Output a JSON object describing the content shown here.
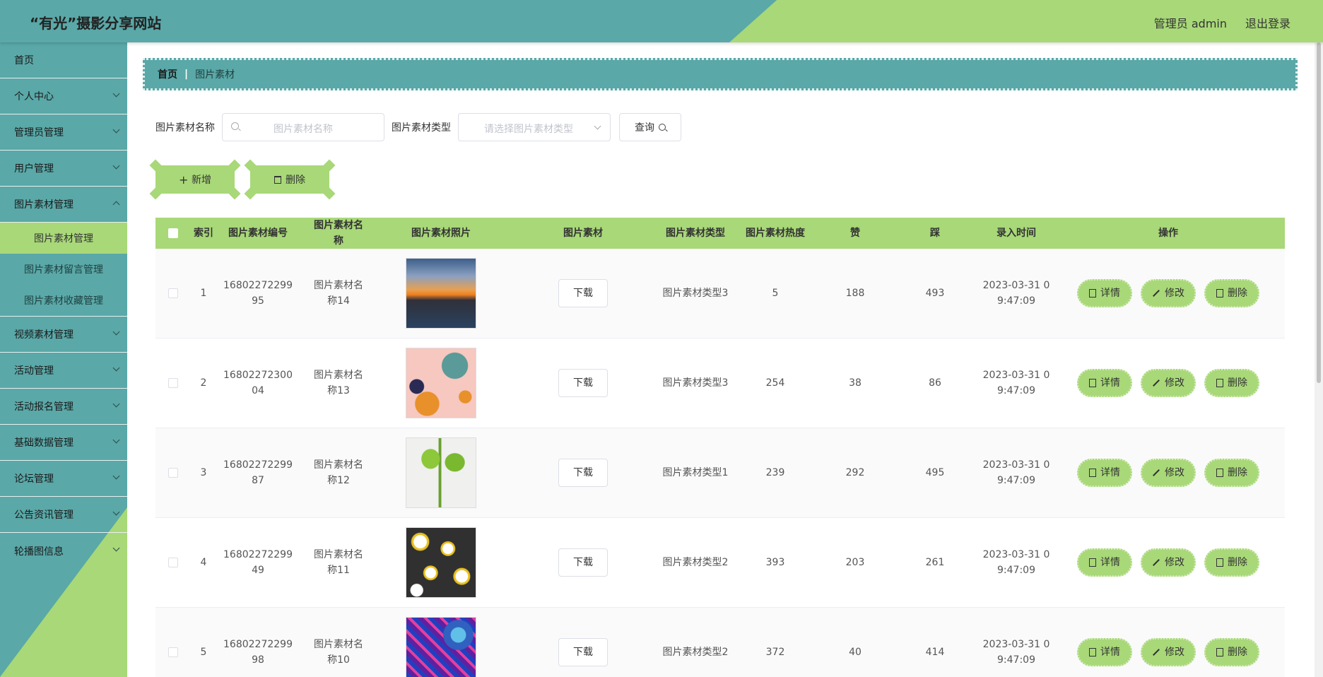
{
  "header": {
    "title": "“有光”摄影分享网站",
    "user": "管理员 admin",
    "logout": "退出登录"
  },
  "sidebar": {
    "items": [
      {
        "label": "首页",
        "has_arrow": false
      },
      {
        "label": "个人中心",
        "has_arrow": true
      },
      {
        "label": "管理员管理",
        "has_arrow": true
      },
      {
        "label": "用户管理",
        "has_arrow": true
      },
      {
        "label": "图片素材管理",
        "has_arrow": true,
        "open": true
      },
      {
        "label": "视频素材管理",
        "has_arrow": true
      },
      {
        "label": "活动管理",
        "has_arrow": true
      },
      {
        "label": "活动报名管理",
        "has_arrow": true
      },
      {
        "label": "基础数据管理",
        "has_arrow": true
      },
      {
        "label": "论坛管理",
        "has_arrow": true
      },
      {
        "label": "公告资讯管理",
        "has_arrow": true
      },
      {
        "label": "轮播图信息",
        "has_arrow": true
      }
    ],
    "submenu": [
      "图片素材管理",
      "图片素材留言管理",
      "图片素材收藏管理"
    ]
  },
  "breadcrumb": {
    "home": "首页",
    "separator": "|",
    "current": "图片素材"
  },
  "search": {
    "name_label": "图片素材名称",
    "name_placeholder": "图片素材名称",
    "type_label": "图片素材类型",
    "type_placeholder": "请选择图片素材类型",
    "query_label": "查询"
  },
  "actions": {
    "add_label": "新增",
    "delete_label": "删除"
  },
  "table": {
    "headers": [
      "索引",
      "图片素材编号",
      "图片素材名称",
      "图片素材照片",
      "图片素材",
      "图片素材类型",
      "图片素材热度",
      "赞",
      "踩",
      "录入时间",
      "操作"
    ],
    "download_label": "下载",
    "op_labels": {
      "detail": "详情",
      "edit": "修改",
      "delete": "删除"
    },
    "rows": [
      {
        "index": "1",
        "code": "1680227229995",
        "name": "图片素材名称14",
        "type": "图片素材类型3",
        "heat": "5",
        "zan": "188",
        "cai": "493",
        "time": "2023-03-31 09:47:09"
      },
      {
        "index": "2",
        "code": "1680227230004",
        "name": "图片素材名称13",
        "type": "图片素材类型3",
        "heat": "254",
        "zan": "38",
        "cai": "86",
        "time": "2023-03-31 09:47:09"
      },
      {
        "index": "3",
        "code": "1680227229987",
        "name": "图片素材名称12",
        "type": "图片素材类型1",
        "heat": "239",
        "zan": "292",
        "cai": "495",
        "time": "2023-03-31 09:47:09"
      },
      {
        "index": "4",
        "code": "1680227229949",
        "name": "图片素材名称11",
        "type": "图片素材类型2",
        "heat": "393",
        "zan": "203",
        "cai": "261",
        "time": "2023-03-31 09:47:09"
      },
      {
        "index": "5",
        "code": "1680227229998",
        "name": "图片素材名称10",
        "type": "图片素材类型2",
        "heat": "372",
        "zan": "40",
        "cai": "414",
        "time": "2023-03-31 09:47:09"
      }
    ]
  },
  "colors": {
    "teal": "#5aa8a8",
    "green": "#a8d878"
  }
}
